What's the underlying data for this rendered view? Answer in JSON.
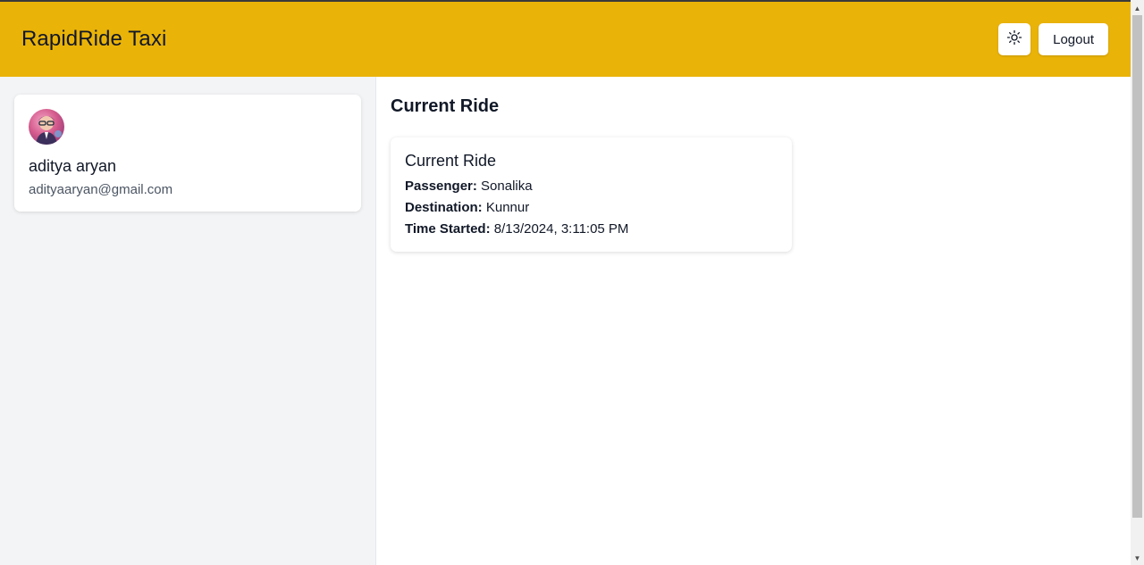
{
  "header": {
    "brand": "RapidRide Taxi",
    "theme_toggle_icon": "sun-icon",
    "logout_label": "Logout",
    "background_color": "#eab308"
  },
  "profile": {
    "name": "aditya aryan",
    "email": "adityaaryan@gmail.com",
    "avatar_icon": "avatar-image"
  },
  "main": {
    "title": "Current Ride",
    "ride": {
      "title": "Current Ride",
      "passenger_label": "Passenger:",
      "passenger": "Sonalika",
      "destination_label": "Destination:",
      "destination": "Kunnur",
      "time_label": "Time Started:",
      "time": "8/13/2024, 3:11:05 PM"
    }
  }
}
